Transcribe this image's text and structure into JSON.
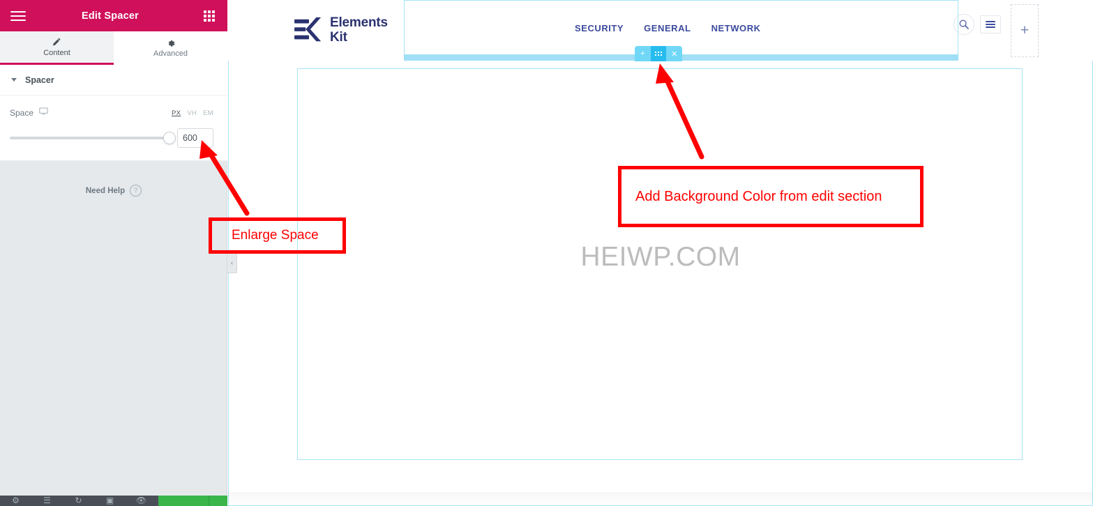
{
  "panel": {
    "header": {
      "title": "Edit Spacer",
      "menu_icon": "hamburger-icon",
      "grid_icon": "widgets-grid-icon"
    },
    "tabs": [
      {
        "label": "Content",
        "icon": "pencil-icon",
        "active": true
      },
      {
        "label": "Advanced",
        "icon": "gear-icon",
        "active": false
      }
    ],
    "accordion": {
      "title": "Spacer",
      "caret_icon": "caret-down-icon"
    },
    "control": {
      "label": "Space",
      "device_icon": "desktop-icon",
      "units": [
        "PX",
        "VH",
        "EM"
      ],
      "active_unit": "PX",
      "value": "600",
      "slider_percent": 100
    },
    "need_help": {
      "label": "Need Help",
      "icon": "question-circle-icon"
    },
    "collapse_handle_icon": "chevron-left-icon",
    "footer": {
      "icons": [
        "settings-icon",
        "navigator-icon",
        "history-icon",
        "responsive-icon",
        "preview-icon"
      ],
      "publish_label": "",
      "publish_color": "#39b54a"
    },
    "colors": {
      "header_bg": "#d0105a",
      "body_bg": "#e5e9ec",
      "accent": "#d0105a"
    }
  },
  "preview": {
    "logo": {
      "line1": "Elements",
      "line2": "Kit",
      "icon": "elementskit-logo-icon",
      "color": "#2b3270"
    },
    "nav": [
      {
        "label": "SECURITY"
      },
      {
        "label": "GENERAL"
      },
      {
        "label": "NETWORK"
      }
    ],
    "header_actions": {
      "search_icon": "search-icon",
      "menu_icon": "hamburger-menu-icon",
      "add_icon": "plus-icon"
    },
    "section_handle": {
      "add_icon": "plus-icon",
      "edit_icon": "section-grid-icon",
      "close_icon": "close-icon",
      "color": "#71d7f7",
      "active_color": "#27bcee"
    },
    "watermark": "HEIWP.COM",
    "highlight_color": "#a6e3f7"
  },
  "annotations": [
    {
      "id": "add-background",
      "text": "Add Background Color from edit section",
      "color": "#ff0000"
    },
    {
      "id": "enlarge-space",
      "text": "Enlarge Space",
      "color": "#ff0000"
    }
  ]
}
